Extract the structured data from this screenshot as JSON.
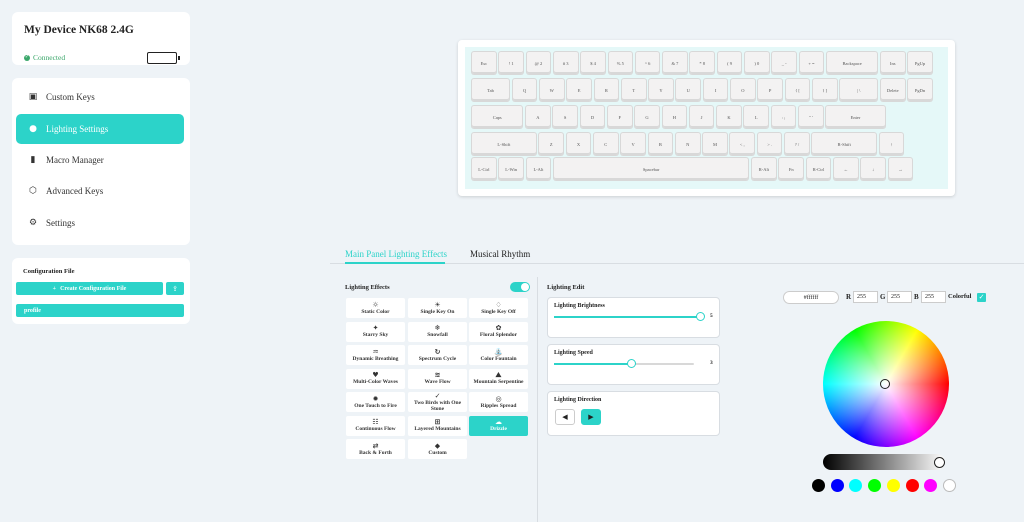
{
  "device": {
    "title": "My Device NK68 2.4G",
    "status": "Connected"
  },
  "nav": [
    {
      "label": "Custom Keys",
      "icon": "keyboard-icon"
    },
    {
      "label": "Lighting Settings",
      "icon": "lightbulb-icon"
    },
    {
      "label": "Macro Manager",
      "icon": "bars-icon"
    },
    {
      "label": "Advanced Keys",
      "icon": "chip-icon"
    },
    {
      "label": "Settings",
      "icon": "gear-icon"
    }
  ],
  "config": {
    "label": "Configuration File",
    "create_label": "Create Configuration File",
    "profile": "profile"
  },
  "keyboard": {
    "rows": [
      [
        "Esc",
        "! 1",
        "@ 2",
        "# 3",
        "$ 4",
        "% 5",
        "^ 6",
        "& 7",
        "* 8",
        "( 9",
        ") 0",
        "_ -",
        "+ =",
        "Backspace",
        "Ins",
        "PgUp"
      ],
      [
        "Tab",
        "Q",
        "W",
        "E",
        "R",
        "T",
        "Y",
        "U",
        "I",
        "O",
        "P",
        "{ [",
        "} ]",
        "| \\",
        "Delete",
        "PgDn"
      ],
      [
        "Caps",
        "A",
        "S",
        "D",
        "F",
        "G",
        "H",
        "J",
        "K",
        "L",
        ": ;",
        "\" '",
        "Enter"
      ],
      [
        "L-Shift",
        "Z",
        "X",
        "C",
        "V",
        "B",
        "N",
        "M",
        "< ,",
        "> .",
        "? /",
        "R-Shift",
        "↑"
      ],
      [
        "L-Ctrl",
        "L-Win",
        "L-Alt",
        "Spacebar",
        "R-Alt",
        "Fn",
        "R-Ctrl",
        "←",
        "↓",
        "→"
      ]
    ]
  },
  "tabs": {
    "main": "Main Panel Lighting Effects",
    "music": "Musical Rhythm"
  },
  "effects": {
    "title": "Lighting Effects",
    "items": [
      {
        "label": "Static Color",
        "icon": "sun-icon"
      },
      {
        "label": "Single Key On",
        "icon": "bulb-icon"
      },
      {
        "label": "Single Key Off",
        "icon": "bulb-outline-icon"
      },
      {
        "label": "Starry Sky",
        "icon": "stars-icon"
      },
      {
        "label": "Snowfall",
        "icon": "snow-icon"
      },
      {
        "label": "Floral Splendor",
        "icon": "flower-icon"
      },
      {
        "label": "Dynamic Breathing",
        "icon": "breath-icon"
      },
      {
        "label": "Spectrum Cycle",
        "icon": "cycle-icon"
      },
      {
        "label": "Color Fountain",
        "icon": "fountain-icon"
      },
      {
        "label": "Multi-Color Waves",
        "icon": "heart-icon"
      },
      {
        "label": "Wave Flow",
        "icon": "wave-icon"
      },
      {
        "label": "Mountain Serpentine",
        "icon": "mountain-icon"
      },
      {
        "label": "One Touch to Fire",
        "icon": "fire-icon"
      },
      {
        "label": "Two Birds with One Stone",
        "icon": "bird-icon"
      },
      {
        "label": "Ripples Spread",
        "icon": "ripple-icon"
      },
      {
        "label": "Continuous Flow",
        "icon": "flow-icon"
      },
      {
        "label": "Layered Mountains",
        "icon": "layers-icon"
      },
      {
        "label": "Drizzle",
        "icon": "cloud-icon"
      },
      {
        "label": "Back & Forth",
        "icon": "arrows-icon"
      },
      {
        "label": "Custom",
        "icon": "custom-icon"
      }
    ],
    "active": "Drizzle"
  },
  "edit": {
    "title": "Lighting Edit",
    "brightness": {
      "label": "Lighting Brightness",
      "value": "5",
      "fraction": 1.0
    },
    "speed": {
      "label": "Lighting Speed",
      "value": "3",
      "fraction": 0.55
    },
    "direction": {
      "label": "Lighting Direction"
    }
  },
  "color": {
    "hex": "#ffffff",
    "r_label": "R",
    "r": "255",
    "g_label": "G",
    "g": "255",
    "b_label": "B",
    "b": "255",
    "colorful_label": "Colorful",
    "colorful": true,
    "swatches": [
      "#000000",
      "#0000ff",
      "#00ffff",
      "#00ff00",
      "#ffff00",
      "#ff0000",
      "#ff00ff",
      "#ffffff"
    ]
  },
  "accent": "#2cd3c9"
}
